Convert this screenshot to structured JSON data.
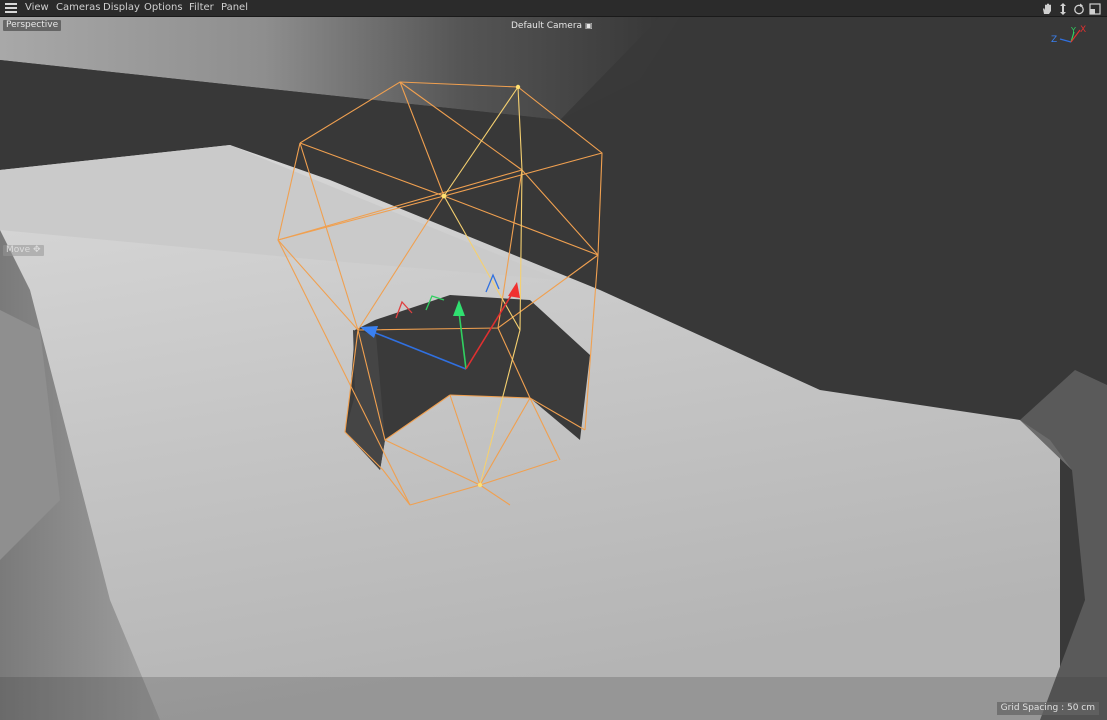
{
  "menu": {
    "items": [
      "View",
      "Cameras",
      "Display",
      "Options",
      "Filter",
      "Panel"
    ]
  },
  "nav_icons": [
    "hand-pan-icon",
    "move-arrows-icon",
    "rotate-icon",
    "maximize-icon"
  ],
  "viewport": {
    "projection_label": "Perspective",
    "camera_label": "Default Camera",
    "tool_label": "Move",
    "grid_spacing_label": "Grid Spacing : 50 cm",
    "axis_gizmo": {
      "x": "X",
      "y": "Y",
      "z": "Z"
    },
    "colors": {
      "selection_wire": "#f0a050",
      "axis_x": "#e03030",
      "axis_y": "#30d060",
      "axis_z": "#3070e0"
    }
  }
}
